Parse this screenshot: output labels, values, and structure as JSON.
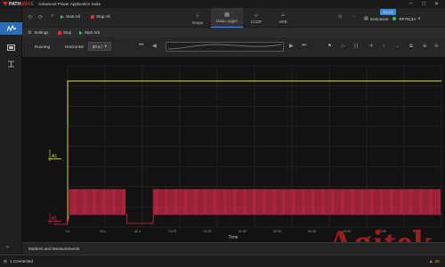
{
  "app": {
    "logo_main": "PATH",
    "logo_accent": "WAVE",
    "title": "Advanced Power Application Suite",
    "revision": "3.2.2.0"
  },
  "toolbar": {
    "help": "?",
    "start_all": "Start All",
    "stop_all": "Stop All",
    "instrument_label": "Instrument",
    "instrument_name": "RP7913A",
    "modes": [
      {
        "label": "Scope",
        "icon": "scope-icon"
      },
      {
        "label": "Data Logger",
        "icon": "data-logger-icon"
      },
      {
        "label": "CCDF",
        "icon": "ccdf-icon"
      },
      {
        "label": "ARB",
        "icon": "arb-icon"
      }
    ]
  },
  "sub_toolbar": {
    "settings": "Settings",
    "stop": "Stop",
    "start_arb": "Start Arb"
  },
  "datalogger": {
    "status": "Running",
    "horizontal_label": "Horizontal",
    "horizontal_value": "20 s /"
  },
  "channel_markers": {
    "voltage": "A1",
    "current": "A1"
  },
  "chart_data": {
    "type": "line",
    "xlabel": "Time",
    "x_ticks": [
      "0 s",
      "20 s",
      "40 s",
      "01:00",
      "01:20",
      "01:40",
      "02:00",
      "02:20",
      "02:40",
      "03:00",
      "03:20"
    ],
    "series": [
      {
        "color": "#e8e33a",
        "values": [
          {
            "t_s": 0,
            "level": "high"
          },
          {
            "t_s": 214,
            "level": "high"
          }
        ]
      },
      {
        "color": "#d42a4a",
        "values": [
          {
            "t_s": 0,
            "pattern": "step-high"
          },
          {
            "t_s": 1,
            "pattern": "pulses"
          },
          {
            "t_s": 34,
            "pattern": "low"
          },
          {
            "t_s": 49,
            "pattern": "pulses"
          },
          {
            "t_s": 214,
            "pattern": "pulses"
          }
        ]
      }
    ],
    "grid": true,
    "grid_columns": 10,
    "grid_rows": 8
  },
  "markers_panel": {
    "label": "Markers and Measurements"
  },
  "statusbar": {
    "connected": "1 Connected",
    "warnings": "33"
  },
  "watermark": "Agitek",
  "colors": {
    "accent": "#2a6ebb",
    "voltage_trace": "#e8e33a",
    "current_trace": "#d42a4a",
    "start_green": "#34c759",
    "stop_red": "#e0302a"
  }
}
